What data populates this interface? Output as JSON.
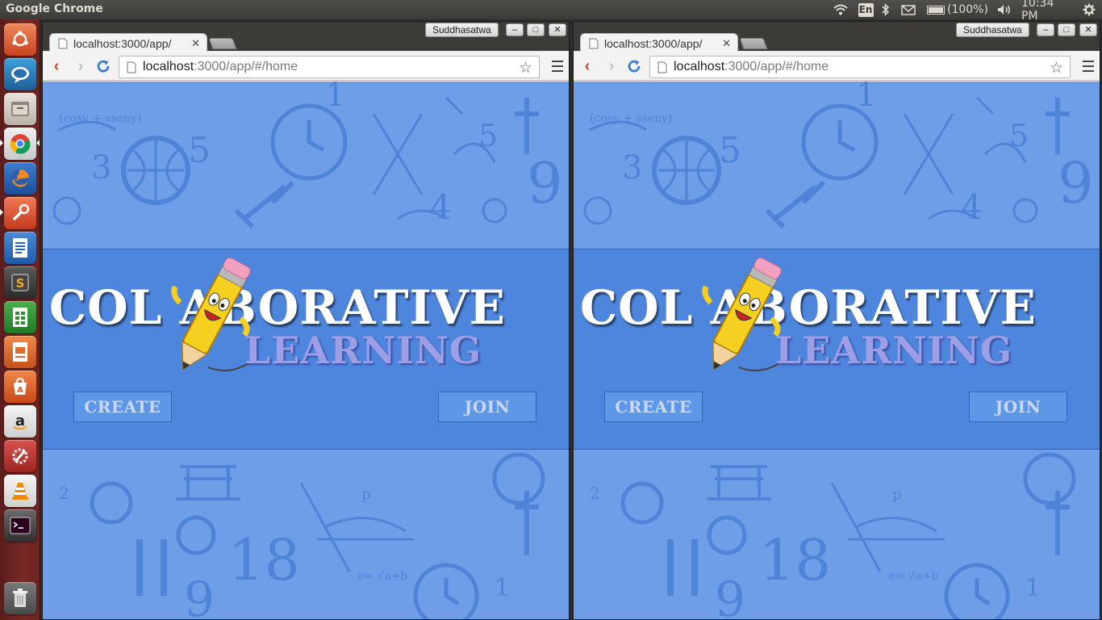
{
  "top_panel": {
    "app_name": "Google Chrome",
    "language": "En",
    "battery": "(100%)",
    "clock": "10:34 PM"
  },
  "launcher": {
    "items": [
      "ubuntu-dash-icon",
      "chat-icon",
      "file-manager-icon",
      "chrome-icon",
      "firefox-icon",
      "tool-icon",
      "writer-icon",
      "sublime-icon",
      "calc-icon",
      "impress-icon",
      "software-center-icon",
      "amazon-icon",
      "settings-icon",
      "vlc-icon",
      "terminal-icon",
      "trash-icon"
    ]
  },
  "windows": [
    {
      "user": "Suddhasatwa",
      "tab_title": "localhost:3000/app/",
      "url_host": "localhost",
      "url_rest": ":3000/app/#/home",
      "page": {
        "logo_title": "COL ABORATIVE",
        "logo_sub": "LEARNING",
        "create_label": "CREATE",
        "join_label": "JOIN"
      }
    },
    {
      "user": "Suddhasatwa",
      "tab_title": "localhost:3000/app/",
      "url_host": "localhost",
      "url_rest": ":3000/app/#/home",
      "page": {
        "logo_title": "COL ABORATIVE",
        "logo_sub": "LEARNING",
        "create_label": "CREATE",
        "join_label": "JOIN"
      }
    }
  ],
  "colors": {
    "hero": "#4e86de",
    "background": "#6f9ee9",
    "button": "#5e96e8",
    "logo_sub": "#9e9ee6"
  }
}
